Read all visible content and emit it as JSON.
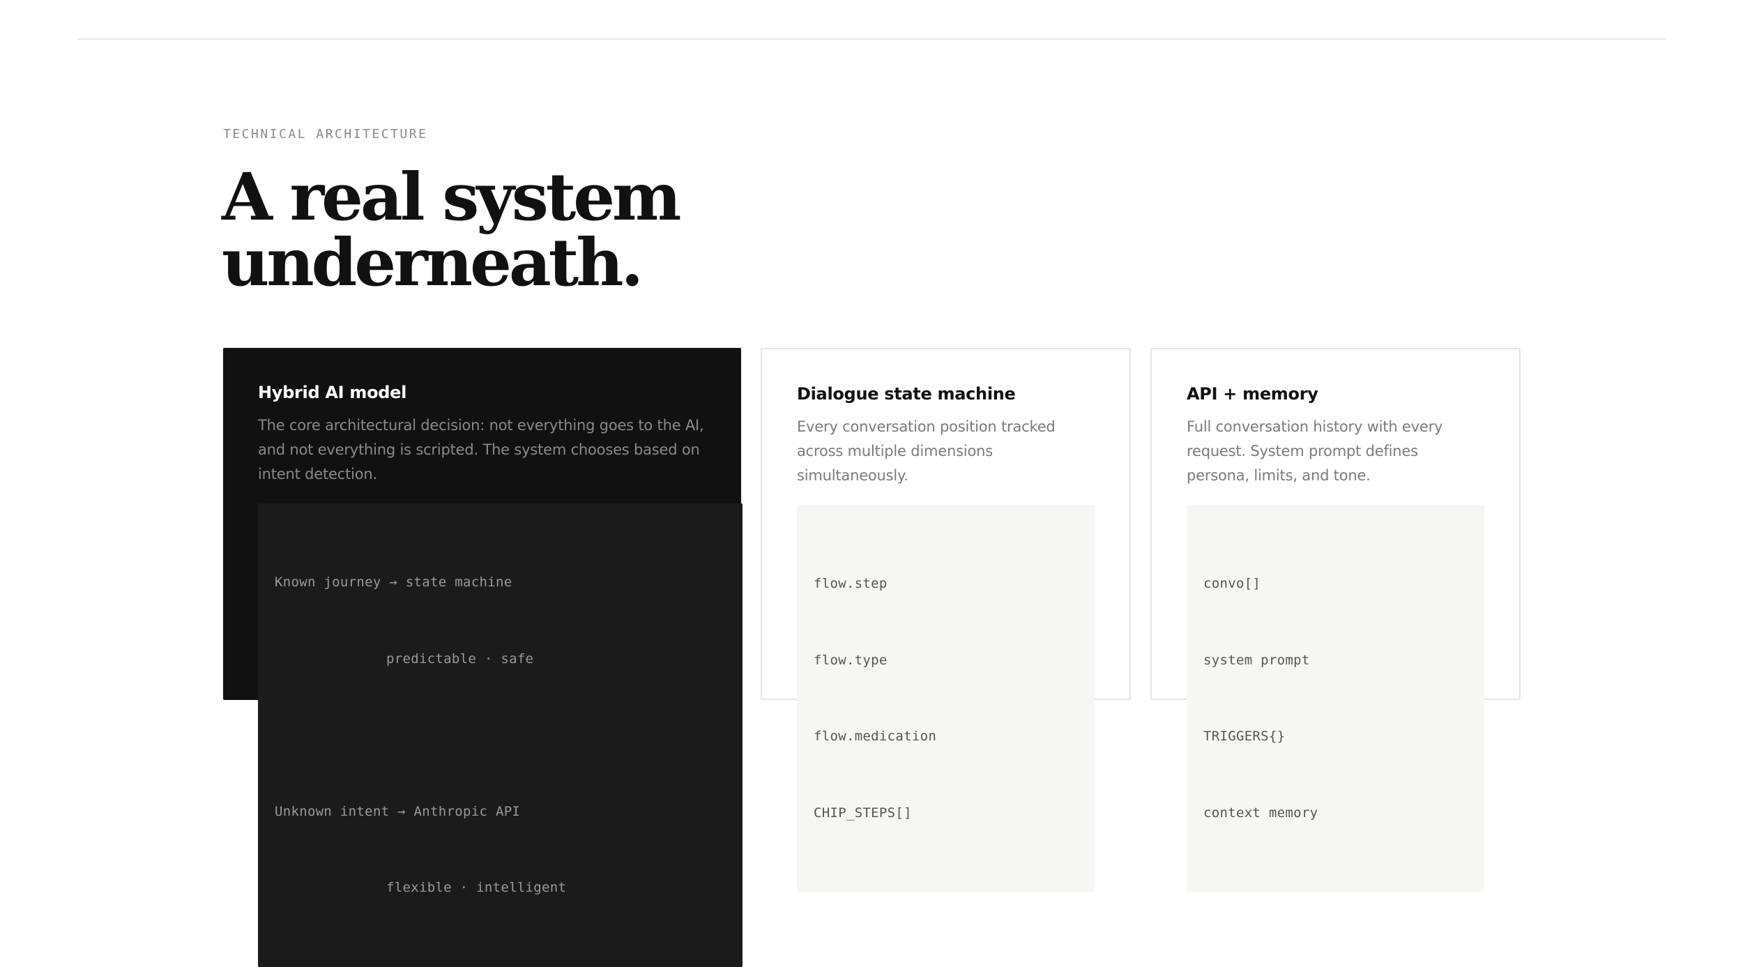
{
  "section": {
    "eyebrow": "TECHNICAL ARCHITECTURE",
    "headline_line1": "A real system",
    "headline_line2": "underneath."
  },
  "cards": [
    {
      "title": "Hybrid AI model",
      "description": "The core architectural decision: not everything goes to the AI, and not everything is scripted. The system chooses based on intent detection.",
      "code": [
        "Known journey → state machine",
        "predictable · safe",
        "",
        "Unknown intent → Anthropic API",
        "flexible · intelligent"
      ]
    },
    {
      "title": "Dialogue state machine",
      "description": "Every conversation position tracked across multiple dimensions simultaneously.",
      "code": [
        "flow.step",
        "flow.type",
        "flow.medication",
        "CHIP_STEPS[]"
      ]
    },
    {
      "title": "API + memory",
      "description": "Full conversation history with every request. System prompt defines persona, limits, and tone.",
      "code": [
        "convo[]",
        "system prompt",
        "TRIGGERS{}",
        "context memory"
      ]
    }
  ],
  "colors": {
    "dark_card": "#111111",
    "code_dark": "#1b1b1b",
    "code_light": "#f6f6f4",
    "border": "#e6e6e6",
    "muted_text": "#8a8a8a"
  }
}
